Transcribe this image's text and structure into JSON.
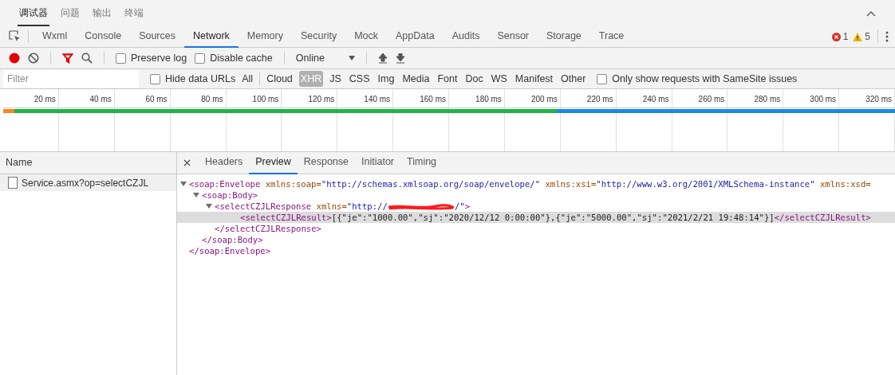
{
  "panel_tabs": [
    {
      "label": "调试器",
      "selected": true
    },
    {
      "label": "问题",
      "selected": false
    },
    {
      "label": "输出",
      "selected": false
    },
    {
      "label": "终端",
      "selected": false
    }
  ],
  "devtools_tabs": [
    {
      "label": "Wxml",
      "selected": false
    },
    {
      "label": "Console",
      "selected": false
    },
    {
      "label": "Sources",
      "selected": false
    },
    {
      "label": "Network",
      "selected": true
    },
    {
      "label": "Memory",
      "selected": false
    },
    {
      "label": "Security",
      "selected": false
    },
    {
      "label": "Mock",
      "selected": false
    },
    {
      "label": "AppData",
      "selected": false
    },
    {
      "label": "Audits",
      "selected": false
    },
    {
      "label": "Sensor",
      "selected": false
    },
    {
      "label": "Storage",
      "selected": false
    },
    {
      "label": "Trace",
      "selected": false
    }
  ],
  "issues": {
    "errors": "1",
    "warnings": "5"
  },
  "toolbar": {
    "recording": true,
    "filter_active": true,
    "preserve_log": {
      "label": "Preserve log",
      "checked": false
    },
    "disable_cache": {
      "label": "Disable cache",
      "checked": false
    },
    "throttling": "Online"
  },
  "filter_bar": {
    "placeholder": "Filter",
    "hide_data_urls": {
      "label": "Hide data URLs",
      "checked": false
    },
    "types": [
      {
        "label": "All",
        "selected": false
      },
      {
        "label": "Cloud",
        "selected": false
      },
      {
        "label": "XHR",
        "selected": true
      },
      {
        "label": "JS",
        "selected": false
      },
      {
        "label": "CSS",
        "selected": false
      },
      {
        "label": "Img",
        "selected": false
      },
      {
        "label": "Media",
        "selected": false
      },
      {
        "label": "Font",
        "selected": false
      },
      {
        "label": "Doc",
        "selected": false
      },
      {
        "label": "WS",
        "selected": false
      },
      {
        "label": "Manifest",
        "selected": false
      },
      {
        "label": "Other",
        "selected": false
      }
    ],
    "samesite": {
      "label": "Only show requests with SameSite issues",
      "checked": false
    }
  },
  "timeline": {
    "ticks": [
      "20 ms",
      "40 ms",
      "60 ms",
      "80 ms",
      "100 ms",
      "120 ms",
      "140 ms",
      "160 ms",
      "180 ms",
      "200 ms",
      "220 ms",
      "240 ms",
      "260 ms",
      "280 ms",
      "300 ms",
      "320 ms"
    ]
  },
  "requests": {
    "column": "Name",
    "rows": [
      {
        "name": "Service.asmx?op=selectCZJL",
        "selected": true
      }
    ]
  },
  "detail_tabs": [
    {
      "label": "Headers",
      "selected": false
    },
    {
      "label": "Preview",
      "selected": true
    },
    {
      "label": "Response",
      "selected": false
    },
    {
      "label": "Initiator",
      "selected": false
    },
    {
      "label": "Timing",
      "selected": false
    }
  ],
  "preview": {
    "open": [
      {
        "kind": "tag",
        "text": "<soap:Envelope"
      },
      {
        "kind": "attr",
        "text": " xmlns:soap="
      },
      {
        "kind": "value",
        "text": "\"http://schemas.xmlsoap.org/soap/envelope/\""
      },
      {
        "kind": "attr",
        "text": " xmlns:xsi="
      },
      {
        "kind": "value",
        "text": "\"http://www.w3.org/2001/XMLSchema-instance\""
      },
      {
        "kind": "attr",
        "text": " xmlns:xsd="
      }
    ],
    "expanded": true,
    "selected": false,
    "close": [
      {
        "kind": "tag",
        "text": "</soap:Envelope>"
      }
    ],
    "children": [
      {
        "open": [
          {
            "kind": "tag",
            "text": "<soap:Body>"
          }
        ],
        "expanded": true,
        "selected": false,
        "close": [
          {
            "kind": "tag",
            "text": "</soap:Body>"
          }
        ],
        "children": [
          {
            "open": [
              {
                "kind": "tag",
                "text": "<selectCZJLResponse"
              },
              {
                "kind": "attr",
                "text": " xmlns="
              },
              {
                "kind": "value",
                "text": "\"http://"
              },
              {
                "kind": "redacted"
              },
              {
                "kind": "value",
                "text": "/\""
              },
              {
                "kind": "tag",
                "text": ">"
              }
            ],
            "expanded": true,
            "selected": false,
            "close": [
              {
                "kind": "tag",
                "text": "</selectCZJLResponse>"
              }
            ],
            "children": [
              {
                "open": [
                  {
                    "kind": "tag",
                    "text": "<selectCZJLResult>"
                  },
                  {
                    "kind": "text",
                    "text": "[{\"je\":\"1000.00\",\"sj\":\"2020/12/12 0:00:00\"},{\"je\":\"5000.00\",\"sj\":\"2021/2/21 19:48:14\"}]"
                  },
                  {
                    "kind": "tag",
                    "text": "</selectCZJLResult>"
                  }
                ],
                "selected": true
              }
            ]
          }
        ]
      }
    ]
  }
}
